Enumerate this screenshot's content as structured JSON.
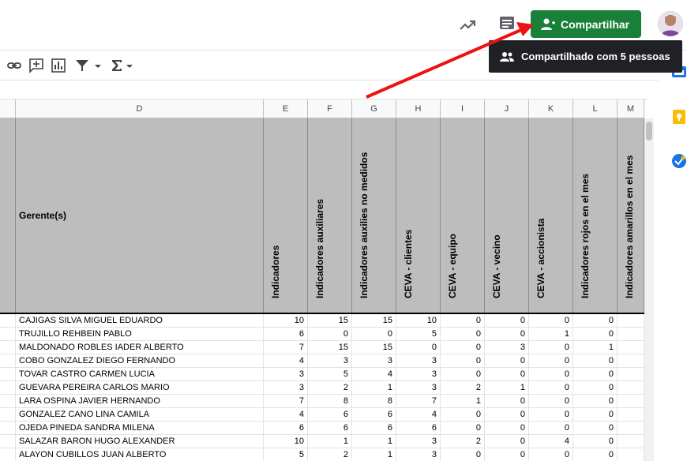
{
  "topbar": {
    "share_label": "Compartilhar",
    "tooltip": "Compartilhado com 5 pessoas",
    "share_color": "#188038"
  },
  "columns": [
    "D",
    "E",
    "F",
    "G",
    "H",
    "I",
    "J",
    "K",
    "L",
    "M"
  ],
  "header": {
    "gerente": "Gerente(s)",
    "vertical": [
      "Indicadores",
      "Indicadores auxiliares",
      "Indicadores auxilies no medidos",
      "CEVA - clientes",
      "CEVA - equipo",
      "CEVA - vecino",
      "CEVA - accionista",
      "Indicadores rojos en el mes",
      "Indicadores amarillos en el mes"
    ]
  },
  "rows": [
    {
      "name": "CAJIGAS SILVA MIGUEL EDUARDO",
      "v": [
        "10",
        "15",
        "15",
        "10",
        "0",
        "0",
        "0",
        "0"
      ]
    },
    {
      "name": "TRUJILLO REHBEIN PABLO",
      "v": [
        "6",
        "0",
        "0",
        "5",
        "0",
        "0",
        "1",
        "0"
      ]
    },
    {
      "name": "MALDONADO ROBLES IADER ALBERTO",
      "v": [
        "7",
        "15",
        "15",
        "0",
        "0",
        "3",
        "0",
        "1"
      ]
    },
    {
      "name": "COBO GONZALEZ DIEGO FERNANDO",
      "v": [
        "4",
        "3",
        "3",
        "3",
        "0",
        "0",
        "0",
        "0"
      ]
    },
    {
      "name": "TOVAR CASTRO CARMEN LUCIA",
      "v": [
        "3",
        "5",
        "4",
        "3",
        "0",
        "0",
        "0",
        "0"
      ]
    },
    {
      "name": "GUEVARA PEREIRA CARLOS MARIO",
      "v": [
        "3",
        "2",
        "1",
        "3",
        "2",
        "1",
        "0",
        "0"
      ]
    },
    {
      "name": "LARA OSPINA JAVIER HERNANDO",
      "v": [
        "7",
        "8",
        "8",
        "7",
        "1",
        "0",
        "0",
        "0"
      ]
    },
    {
      "name": "GONZALEZ CANO LINA CAMILA",
      "v": [
        "4",
        "6",
        "6",
        "4",
        "0",
        "0",
        "0",
        "0"
      ]
    },
    {
      "name": "OJEDA PINEDA SANDRA MILENA",
      "v": [
        "6",
        "6",
        "6",
        "6",
        "0",
        "0",
        "0",
        "0"
      ]
    },
    {
      "name": "SALAZAR BARON HUGO ALEXANDER",
      "v": [
        "10",
        "1",
        "1",
        "3",
        "2",
        "0",
        "4",
        "0"
      ]
    },
    {
      "name": "ALAYON CUBILLOS JUAN ALBERTO",
      "v": [
        "5",
        "2",
        "1",
        "3",
        "0",
        "0",
        "0",
        "0"
      ]
    }
  ]
}
